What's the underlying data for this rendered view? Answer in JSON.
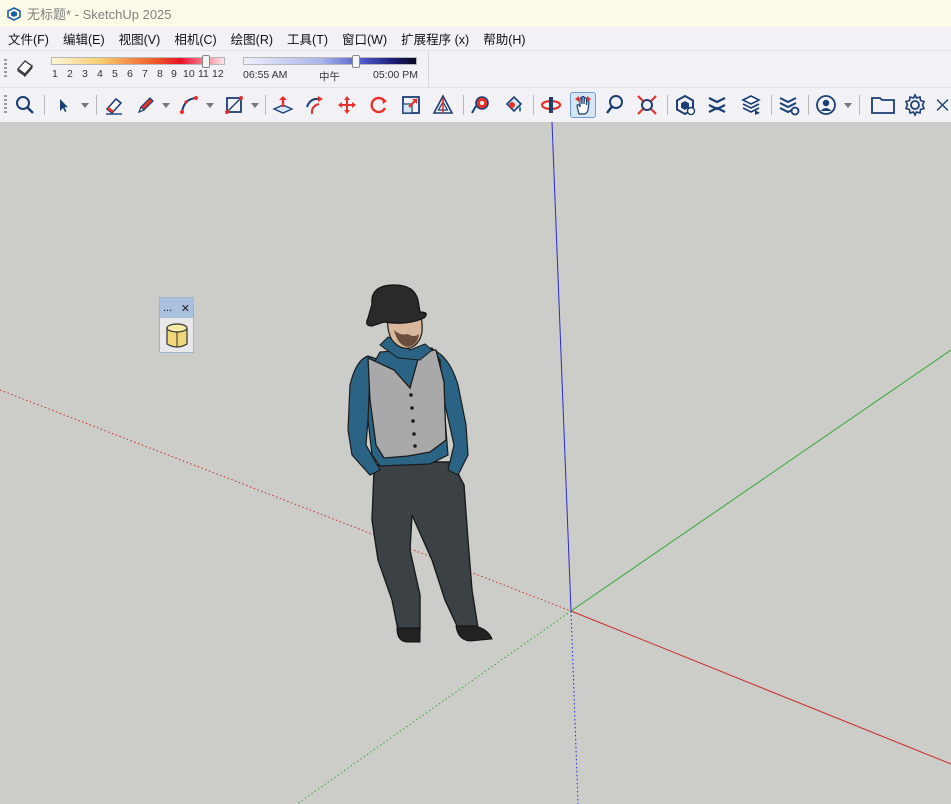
{
  "window": {
    "title": "无标题* - SketchUp 2025"
  },
  "menu": [
    "文件(F)",
    "编辑(E)",
    "视图(V)",
    "相机(C)",
    "绘图(R)",
    "工具(T)",
    "窗口(W)",
    "扩展程序 (x)",
    "帮助(H)"
  ],
  "shadow_settings": {
    "month_ticks": [
      "1",
      "2",
      "3",
      "4",
      "5",
      "6",
      "7",
      "8",
      "9",
      "10",
      "11",
      "12"
    ],
    "month_value": 11,
    "time_start": "06:55 AM",
    "time_mid": "中午",
    "time_end": "05:00 PM",
    "time_value": "14:40"
  },
  "toolbar": {
    "buttons": [
      "zoom-extents",
      "select",
      "eraser",
      "pencil-line",
      "arc",
      "rectangle",
      "push-pull",
      "follow-me",
      "move",
      "rotate",
      "scale",
      "offset",
      "tape-measure",
      "paint-bucket",
      "orbit",
      "pan",
      "zoom",
      "zoom-window",
      "components",
      "sections",
      "layers",
      "layer-settings",
      "account",
      "open-folder",
      "settings",
      "close"
    ],
    "active_button": "pan"
  },
  "float_panel": {
    "label": "...",
    "close": "✕"
  },
  "colors": {
    "viewport_bg": "#cccdc8",
    "axis_red": "#cc2b2b",
    "axis_green": "#35a835",
    "axis_blue": "#2b2bcc",
    "accent": "#1b5fa8"
  }
}
